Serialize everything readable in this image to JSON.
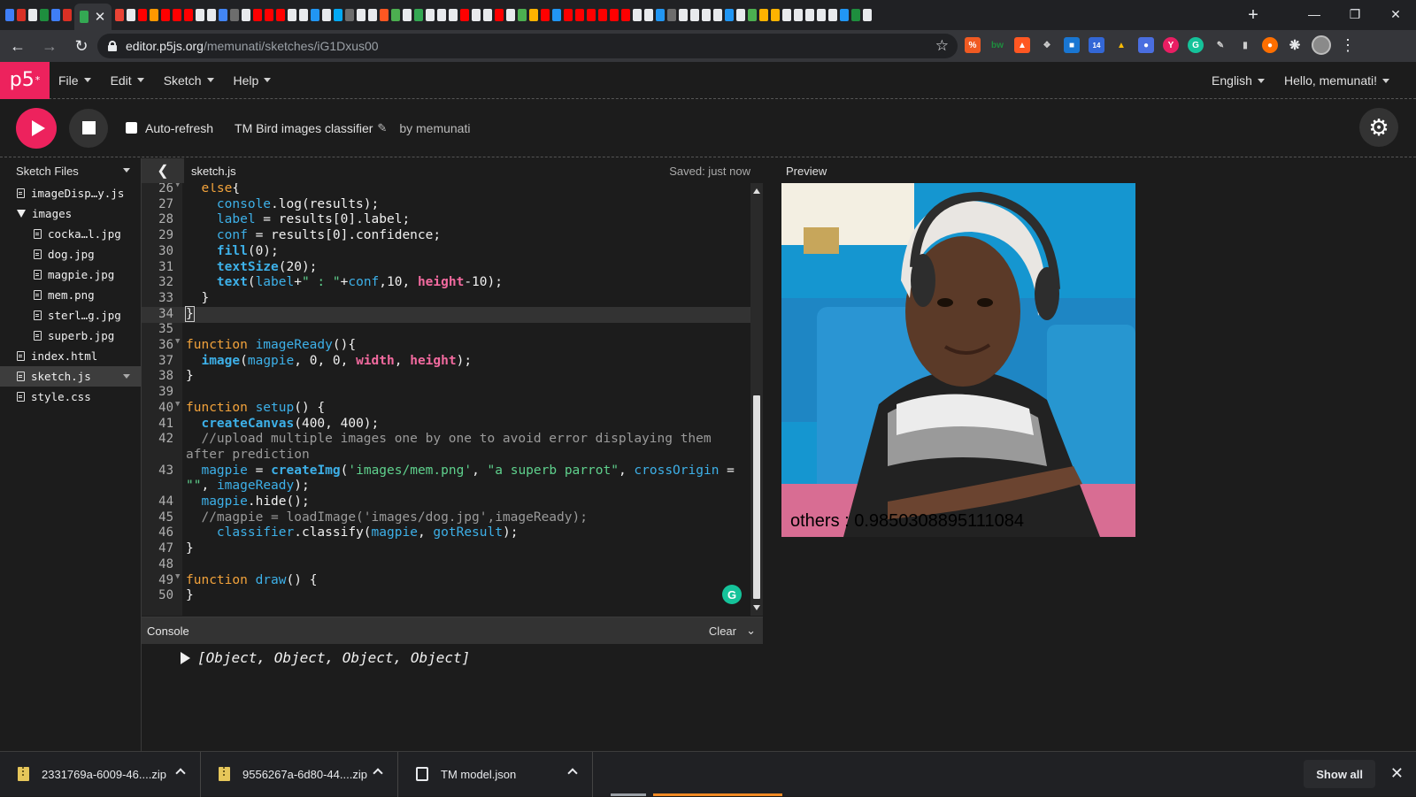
{
  "browser": {
    "active_tab_close": "✕",
    "new_tab": "+",
    "url_host": "editor.p5js.org",
    "url_path": "/memunati/sketches/iG1Dxus00",
    "favicon_colors": [
      "#3f7ef6",
      "#d93025",
      "#e8eaed",
      "#1e8e3e",
      "#3f7ef6",
      "#d93025",
      "#34a853",
      "#ea4335",
      "#e8eaed",
      "#ff0000",
      "#ff9800",
      "#ff0000",
      "#ff0000",
      "#ff0000",
      "#e8eaed",
      "#e8eaed",
      "#4285f4",
      "#6d6d6d",
      "#e8eaed",
      "#ff0000",
      "#ff0000",
      "#ff0000",
      "#e8eaed",
      "#e8eaed",
      "#2196f3",
      "#e8eaed",
      "#03a9f4",
      "#6d6d6d",
      "#e8eaed",
      "#e8eaed",
      "#ff5722",
      "#4caf50",
      "#e8eaed",
      "#34a853",
      "#e8eaed",
      "#e8eaed",
      "#e8eaed",
      "#ff0000",
      "#e8eaed",
      "#e8eaed",
      "#ff0000",
      "#e8eaed",
      "#4caf50",
      "#ffb300",
      "#ff0000",
      "#2196f3",
      "#ff0000",
      "#ff0000",
      "#ff0000",
      "#ff0000",
      "#ff0000",
      "#ff0000",
      "#e8eaed",
      "#e8eaed",
      "#2196f3",
      "#6d6d6d",
      "#e8eaed",
      "#e8eaed",
      "#e8eaed",
      "#e8eaed",
      "#2196f3",
      "#e8eaed",
      "#4caf50",
      "#ffb300",
      "#ffb300",
      "#e8eaed",
      "#e8eaed",
      "#e8eaed",
      "#e8eaed",
      "#e8eaed",
      "#2196f3",
      "#1e8e3e",
      "#e8eaed"
    ]
  },
  "p5": {
    "logo": "p5",
    "logo_sup": "*",
    "menu": [
      "File",
      "Edit",
      "Sketch",
      "Help"
    ],
    "language": "English",
    "greeting": "Hello, memunati!",
    "accent": "#ed225d"
  },
  "toolbar": {
    "autorefresh_label": "Auto-refresh",
    "sketch_name": "TM Bird images classifier",
    "by_user": "by memunati"
  },
  "sidebar": {
    "title": "Sketch Files",
    "items": [
      {
        "type": "file",
        "name": "imageDisp…y.js",
        "indent": 0
      },
      {
        "type": "folder",
        "name": "images",
        "indent": 0
      },
      {
        "type": "file",
        "name": "cocka…l.jpg",
        "indent": 1
      },
      {
        "type": "file",
        "name": "dog.jpg",
        "indent": 1
      },
      {
        "type": "file",
        "name": "magpie.jpg",
        "indent": 1
      },
      {
        "type": "file",
        "name": "mem.png",
        "indent": 1
      },
      {
        "type": "file",
        "name": "sterl…g.jpg",
        "indent": 1
      },
      {
        "type": "file",
        "name": "superb.jpg",
        "indent": 1
      },
      {
        "type": "file",
        "name": "index.html",
        "indent": 0
      },
      {
        "type": "file",
        "name": "sketch.js",
        "indent": 0,
        "selected": true
      },
      {
        "type": "file",
        "name": "style.css",
        "indent": 0
      }
    ]
  },
  "editor": {
    "filename": "sketch.js",
    "saved": "Saved: just now",
    "lines": [
      {
        "n": "26",
        "fold": true,
        "tokens": [
          [
            "",
            "  "
          ],
          [
            "kw",
            "else"
          ],
          [
            "",
            "{"
          ]
        ]
      },
      {
        "n": "27",
        "tokens": [
          [
            "",
            "    "
          ],
          [
            "var",
            "console"
          ],
          [
            "",
            ".log(results);"
          ]
        ]
      },
      {
        "n": "28",
        "tokens": [
          [
            "",
            "    "
          ],
          [
            "var",
            "label"
          ],
          [
            "",
            " = results[0].label;"
          ]
        ]
      },
      {
        "n": "29",
        "tokens": [
          [
            "",
            "    "
          ],
          [
            "var",
            "conf"
          ],
          [
            "",
            " = results[0].confidence;"
          ]
        ]
      },
      {
        "n": "30",
        "tokens": [
          [
            "",
            "    "
          ],
          [
            "fn-bold",
            "fill"
          ],
          [
            "",
            "(0);"
          ]
        ]
      },
      {
        "n": "31",
        "tokens": [
          [
            "",
            "    "
          ],
          [
            "fn-bold",
            "textSize"
          ],
          [
            "",
            "(20);"
          ]
        ]
      },
      {
        "n": "32",
        "tokens": [
          [
            "",
            "    "
          ],
          [
            "fn-bold",
            "text"
          ],
          [
            "",
            "("
          ],
          [
            "var",
            "label"
          ],
          [
            "",
            "+"
          ],
          [
            "str",
            "\" : \""
          ],
          [
            "",
            "+"
          ],
          [
            "var",
            "conf"
          ],
          [
            "",
            ",10, "
          ],
          [
            "p5c",
            "height"
          ],
          [
            "",
            "-10);"
          ]
        ]
      },
      {
        "n": "33",
        "tokens": [
          [
            "",
            "  }"
          ]
        ]
      },
      {
        "n": "34",
        "current": true,
        "tokens": [
          [
            "",
            "}"
          ]
        ]
      },
      {
        "n": "35",
        "tokens": [
          [
            "",
            ""
          ]
        ]
      },
      {
        "n": "36",
        "fold": true,
        "tokens": [
          [
            "kw",
            "function"
          ],
          [
            "",
            " "
          ],
          [
            "var",
            "imageReady"
          ],
          [
            "",
            "(){"
          ]
        ]
      },
      {
        "n": "37",
        "tokens": [
          [
            "",
            "  "
          ],
          [
            "fn-bold",
            "image"
          ],
          [
            "",
            "("
          ],
          [
            "var",
            "magpie"
          ],
          [
            "",
            ", 0, 0, "
          ],
          [
            "p5c",
            "width"
          ],
          [
            "",
            ", "
          ],
          [
            "p5c",
            "height"
          ],
          [
            "",
            ");"
          ]
        ]
      },
      {
        "n": "38",
        "tokens": [
          [
            "",
            "}"
          ]
        ]
      },
      {
        "n": "39",
        "tokens": [
          [
            "",
            ""
          ]
        ]
      },
      {
        "n": "40",
        "fold": true,
        "tokens": [
          [
            "kw",
            "function"
          ],
          [
            "",
            " "
          ],
          [
            "var",
            "setup"
          ],
          [
            "",
            "() {"
          ]
        ]
      },
      {
        "n": "41",
        "tokens": [
          [
            "",
            "  "
          ],
          [
            "fn-bold",
            "createCanvas"
          ],
          [
            "",
            "(400, 400);"
          ]
        ]
      },
      {
        "n": "42",
        "tokens": [
          [
            "cmt",
            "  //upload multiple images one by one to avoid error displaying them"
          ]
        ]
      },
      {
        "n": "",
        "tokens": [
          [
            "cmt",
            "after prediction"
          ]
        ]
      },
      {
        "n": "43",
        "tokens": [
          [
            "",
            "  "
          ],
          [
            "var",
            "magpie"
          ],
          [
            "",
            " = "
          ],
          [
            "fn-bold",
            "createImg"
          ],
          [
            "",
            "("
          ],
          [
            "str",
            "'images/mem.png'"
          ],
          [
            "",
            ", "
          ],
          [
            "str",
            "\"a superb parrot\""
          ],
          [
            "",
            ", "
          ],
          [
            "var",
            "crossOrigin"
          ],
          [
            "",
            " ="
          ]
        ]
      },
      {
        "n": "",
        "tokens": [
          [
            "str",
            "\"\""
          ],
          [
            "",
            ", "
          ],
          [
            "var",
            "imageReady"
          ],
          [
            "",
            ");"
          ]
        ]
      },
      {
        "n": "44",
        "tokens": [
          [
            "",
            "  "
          ],
          [
            "var",
            "magpie"
          ],
          [
            "",
            ".hide();"
          ]
        ]
      },
      {
        "n": "45",
        "tokens": [
          [
            "cmt",
            "  //magpie = loadImage('images/dog.jpg',imageReady);"
          ]
        ]
      },
      {
        "n": "46",
        "tokens": [
          [
            "",
            "    "
          ],
          [
            "var",
            "classifier"
          ],
          [
            "",
            ".classify("
          ],
          [
            "var",
            "magpie"
          ],
          [
            "",
            ", "
          ],
          [
            "var",
            "gotResult"
          ],
          [
            "",
            ");"
          ]
        ]
      },
      {
        "n": "47",
        "tokens": [
          [
            "",
            "}"
          ]
        ]
      },
      {
        "n": "48",
        "tokens": [
          [
            "",
            ""
          ]
        ]
      },
      {
        "n": "49",
        "fold": true,
        "tokens": [
          [
            "kw",
            "function"
          ],
          [
            "",
            " "
          ],
          [
            "var",
            "draw"
          ],
          [
            "",
            "() {"
          ]
        ]
      },
      {
        "n": "50",
        "tokens": [
          [
            "",
            "}"
          ]
        ]
      }
    ]
  },
  "console": {
    "title": "Console",
    "clear": "Clear",
    "output": "[Object, Object, Object, Object]"
  },
  "preview": {
    "title": "Preview",
    "canvas_text": "others : 0.9850308895111084"
  },
  "downloads": {
    "items": [
      {
        "name": "2331769a-6009-46....zip",
        "icon": "zip-icon"
      },
      {
        "name": "9556267a-6d80-44....zip",
        "icon": "zip-icon"
      },
      {
        "name": "TM model.json",
        "icon": "json-icon"
      }
    ],
    "show_all": "Show all",
    "close": "✕"
  }
}
